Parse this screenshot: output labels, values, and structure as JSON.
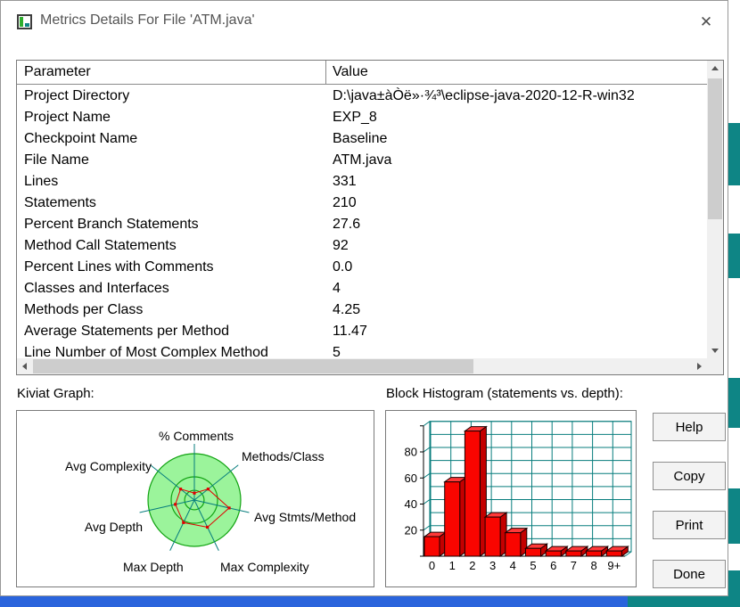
{
  "window": {
    "title": "Metrics Details For File 'ATM.java'",
    "close_glyph": "✕"
  },
  "colors": {
    "bar_red": "#f90500",
    "kiviat_green": "#9bf49b",
    "kiviat_ring_green": "#12a312",
    "grid_teal": "#077d7d",
    "polygon_red": "#e00000",
    "desktop_teal": "#0e8585",
    "background_blue": "#2a64dc"
  },
  "table": {
    "columns": [
      "Parameter",
      "Value"
    ],
    "rows": [
      {
        "parameter": "Project Directory",
        "value": "D:\\java±àÒë»·¾³\\eclipse-java-2020-12-R-win32"
      },
      {
        "parameter": "Project Name",
        "value": "EXP_8"
      },
      {
        "parameter": "Checkpoint Name",
        "value": "Baseline"
      },
      {
        "parameter": "File Name",
        "value": "ATM.java"
      },
      {
        "parameter": "Lines",
        "value": "331"
      },
      {
        "parameter": "Statements",
        "value": "210"
      },
      {
        "parameter": "Percent Branch Statements",
        "value": "27.6"
      },
      {
        "parameter": "Method Call Statements",
        "value": "92"
      },
      {
        "parameter": "Percent Lines with Comments",
        "value": "0.0"
      },
      {
        "parameter": "Classes and Interfaces",
        "value": "4"
      },
      {
        "parameter": "Methods per Class",
        "value": "4.25"
      },
      {
        "parameter": "Average Statements per Method",
        "value": "11.47"
      },
      {
        "parameter": "Line Number of Most Complex Method",
        "value": "5"
      }
    ]
  },
  "kiviat": {
    "label": "Kiviat Graph:",
    "axes": [
      "% Comments",
      "Methods/Class",
      "Avg Stmts/Method",
      "Max Complexity",
      "Max Depth",
      "Avg Depth",
      "Avg Complexity"
    ]
  },
  "histogram": {
    "label": "Block Histogram (statements vs. depth):"
  },
  "buttons": {
    "help": "Help",
    "copy": "Copy",
    "print": "Print",
    "done": "Done"
  },
  "chart_data": [
    {
      "type": "radar",
      "title": "Kiviat Graph",
      "axes": [
        "% Comments",
        "Methods/Class",
        "Avg Stmts/Method",
        "Max Complexity",
        "Max Depth",
        "Avg Depth",
        "Avg Complexity"
      ],
      "values_normalized": [
        0.15,
        0.38,
        0.77,
        0.65,
        0.54,
        0.42,
        0.38
      ],
      "rings": [
        0.21,
        0.5,
        1.0
      ],
      "note": "light-green disc with teal radial axes; red polygon marks file metric positions"
    },
    {
      "type": "bar",
      "title": "Block Histogram (statements vs. depth)",
      "categories": [
        "0",
        "1",
        "2",
        "3",
        "4",
        "5",
        "6",
        "7",
        "8",
        "9+"
      ],
      "values": [
        15,
        57,
        96,
        30,
        18,
        6,
        4,
        4,
        4,
        4
      ],
      "xlabel": "depth",
      "ylabel": "statements",
      "ylim": [
        0,
        100
      ],
      "yticks": [
        0,
        20,
        40,
        60,
        80
      ],
      "grid": true,
      "legend": "none",
      "style": "3d red bars on teal grid"
    }
  ]
}
